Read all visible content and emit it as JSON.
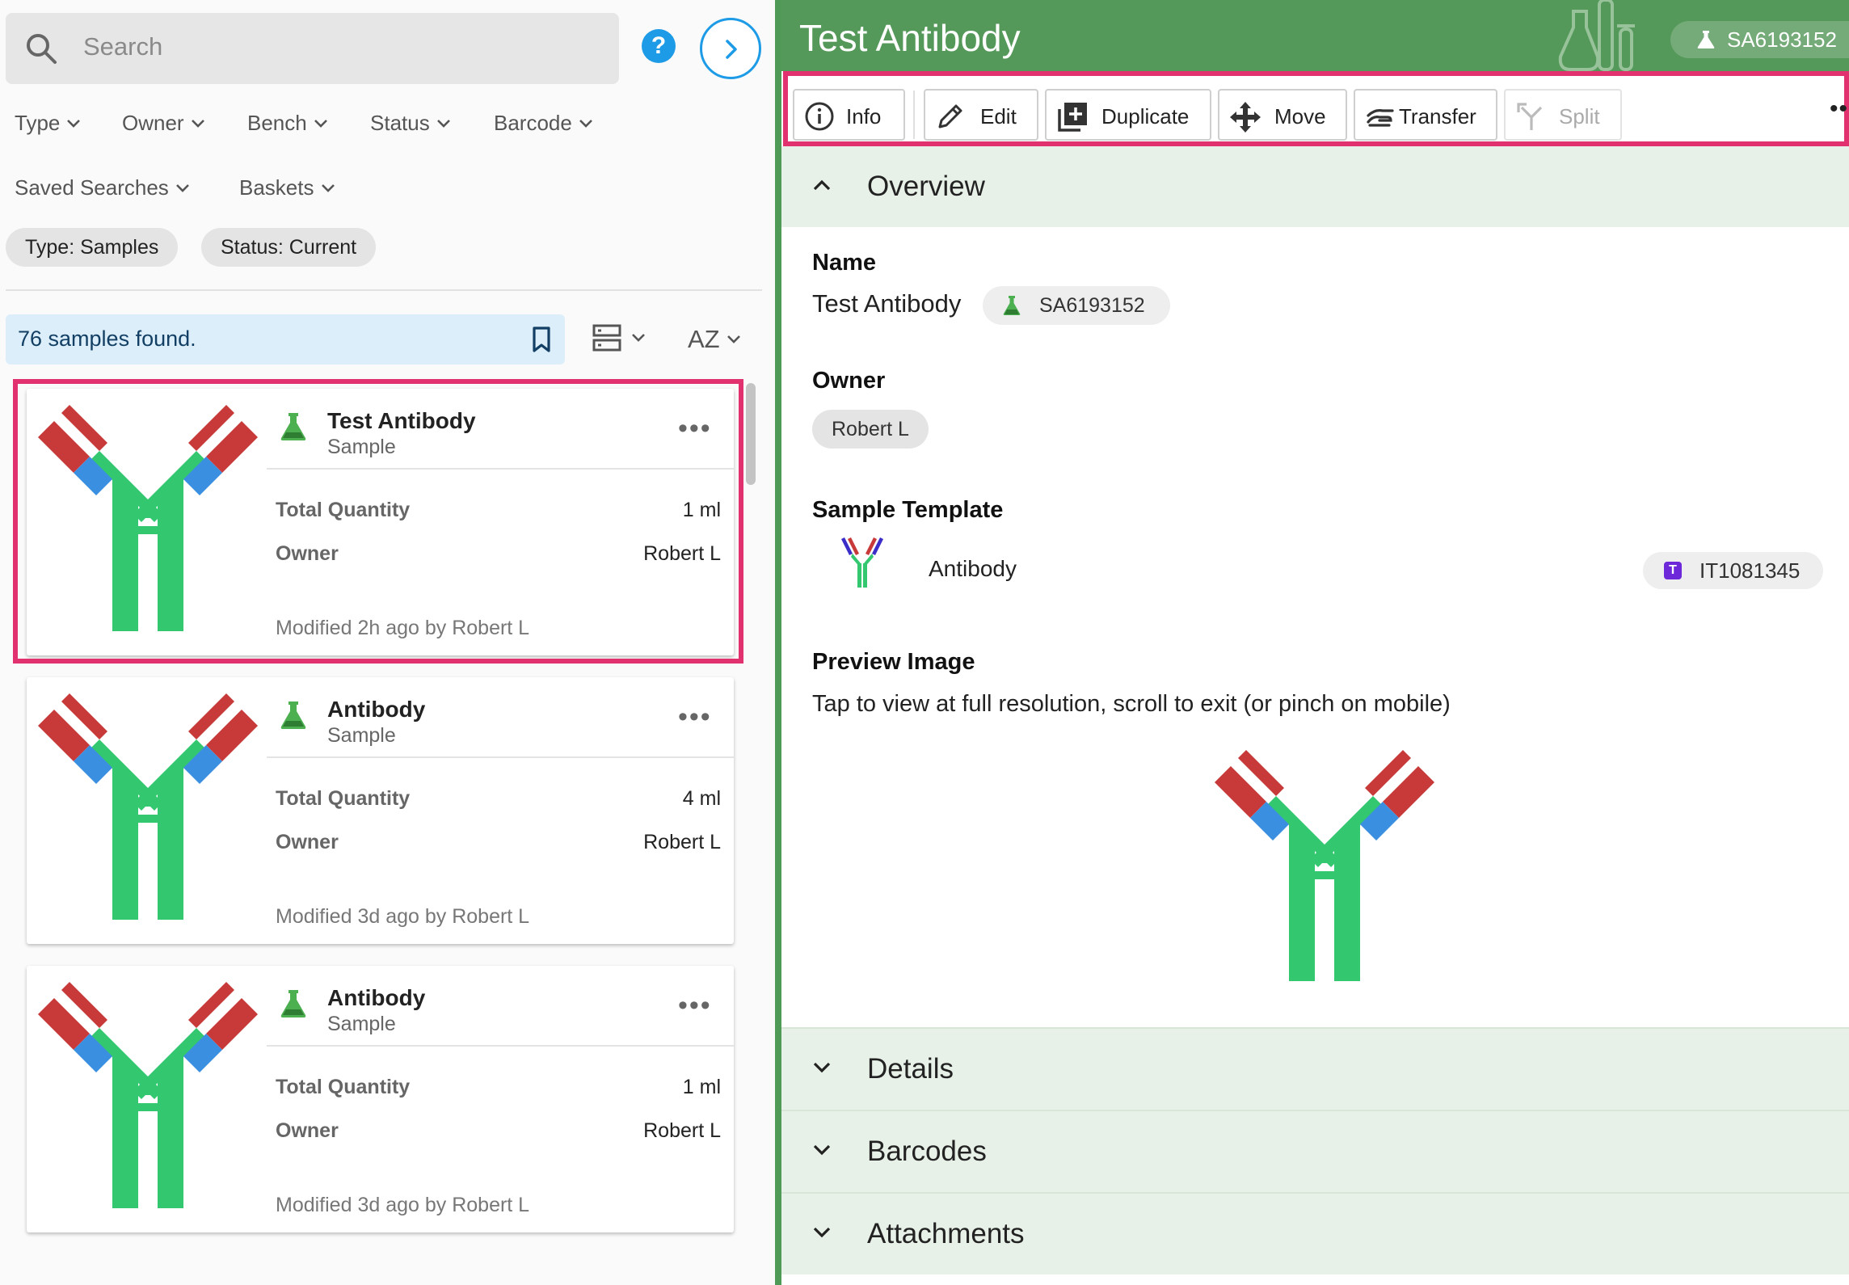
{
  "left": {
    "search_placeholder": "Search",
    "filters": [
      {
        "label": "Type"
      },
      {
        "label": "Owner"
      },
      {
        "label": "Bench"
      },
      {
        "label": "Status"
      },
      {
        "label": "Barcode"
      },
      {
        "label": "Saved Searches"
      },
      {
        "label": "Baskets"
      }
    ],
    "chips": [
      "Type: Samples",
      "Status: Current"
    ],
    "results_text": "76 samples found.",
    "sort_label": "AZ",
    "cards": [
      {
        "title": "Test Antibody",
        "subtitle": "Sample",
        "qty_label": "Total Quantity",
        "qty": "1 ml",
        "owner_label": "Owner",
        "owner": "Robert L",
        "modified": "Modified 2h ago by Robert L",
        "selected": true
      },
      {
        "title": "Antibody",
        "subtitle": "Sample",
        "qty_label": "Total Quantity",
        "qty": "4 ml",
        "owner_label": "Owner",
        "owner": "Robert L",
        "modified": "Modified 3d ago by Robert L",
        "selected": false
      },
      {
        "title": "Antibody",
        "subtitle": "Sample",
        "qty_label": "Total Quantity",
        "qty": "1 ml",
        "owner_label": "Owner",
        "owner": "Robert L",
        "modified": "Modified 3d ago by Robert L",
        "selected": false
      }
    ]
  },
  "right": {
    "title": "Test Antibody",
    "global_id": "SA6193152",
    "toolbar": {
      "info": "Info",
      "edit": "Edit",
      "duplicate": "Duplicate",
      "move": "Move",
      "transfer": "Transfer",
      "split": "Split"
    },
    "sections": {
      "overview": "Overview",
      "details": "Details",
      "barcodes": "Barcodes",
      "attachments": "Attachments"
    },
    "name_label": "Name",
    "name_value": "Test Antibody",
    "name_chip": "SA6193152",
    "owner_label": "Owner",
    "owner_value": "Robert L",
    "template_label": "Sample Template",
    "template_name": "Antibody",
    "template_badge": "T",
    "template_id": "IT1081345",
    "preview_label": "Preview Image",
    "preview_hint": "Tap to view at full resolution, scroll to exit (or pinch on mobile)"
  },
  "colors": {
    "header_green": "#55995a",
    "highlight_pink": "#e2316f",
    "accent_blue": "#1e9be6",
    "antibody_green": "#33c870",
    "antibody_blue": "#3b8fe0",
    "antibody_red": "#c83a3a",
    "template_purple": "#6d28d9"
  }
}
